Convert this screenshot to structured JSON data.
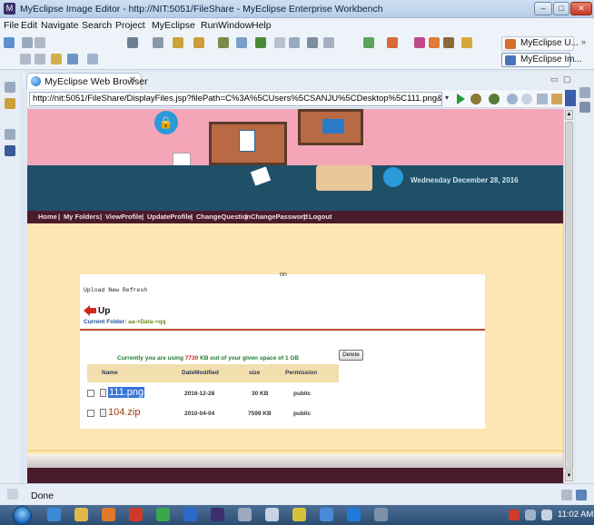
{
  "window": {
    "title": "MyEclipse Image Editor - http://NIT:5051/FileShare - MyEclipse Enterprise Workbench",
    "minimize": "–",
    "maximize": "□",
    "close": "✕"
  },
  "menu": [
    "File",
    "Edit",
    "Navigate",
    "Search",
    "Project",
    "MyEclipse",
    "Run",
    "Window",
    "Help"
  ],
  "perspectives": [
    "MyEclipse U...",
    "MyEclipse Im..."
  ],
  "tab": {
    "label": "MyEclipse Web Browser",
    "close": "✕"
  },
  "browser": {
    "url": "http://nit:5051/FileShare/DisplayFiles.jsp?filePath=C%3A%5CUsers%5CSANJU%5CDesktop%5C111.png&status=on&permissionType="
  },
  "site": {
    "date": "Wednesday December 28, 2016",
    "nav": [
      "Home",
      "|",
      "My Folders",
      "|",
      "ViewProfile",
      "|",
      "UpdateProfile",
      "|",
      "ChangeQuestion",
      "|",
      "ChangePassword",
      "|",
      "Logout"
    ],
    "panel_top_text": "on",
    "upload_links": "Upload New Refresh",
    "up_label": "Up",
    "current_folder_label": "Current Folder:",
    "current_folder_path": "aa->Data->qq",
    "usage_prefix": "Currently you are using",
    "usage_amount": "7730",
    "usage_suffix": "KB out of your given space of 1 GB",
    "delete_label": "Delete",
    "columns": [
      "Name",
      "DateModified",
      "size",
      "Permission"
    ],
    "files": [
      {
        "name": "111.png",
        "date": "2016-12-28",
        "size": "30 KB",
        "permission": "public",
        "selected": true
      },
      {
        "name": "104.zip",
        "date": "2010-04-04",
        "size": "7599 KB",
        "permission": "public",
        "selected": false
      }
    ]
  },
  "status": {
    "text": "Done"
  },
  "taskbar": {
    "clock": "11:02 AM"
  },
  "colors": {
    "banner_pink": "#f4a6b8",
    "banner_blue": "#1f5068",
    "nav_dark": "#4a1b2b",
    "page_cream": "#fde6b3",
    "table_header": "#f2dfad",
    "usage_green": "#1c7a2c",
    "usage_red": "#d0271a"
  }
}
